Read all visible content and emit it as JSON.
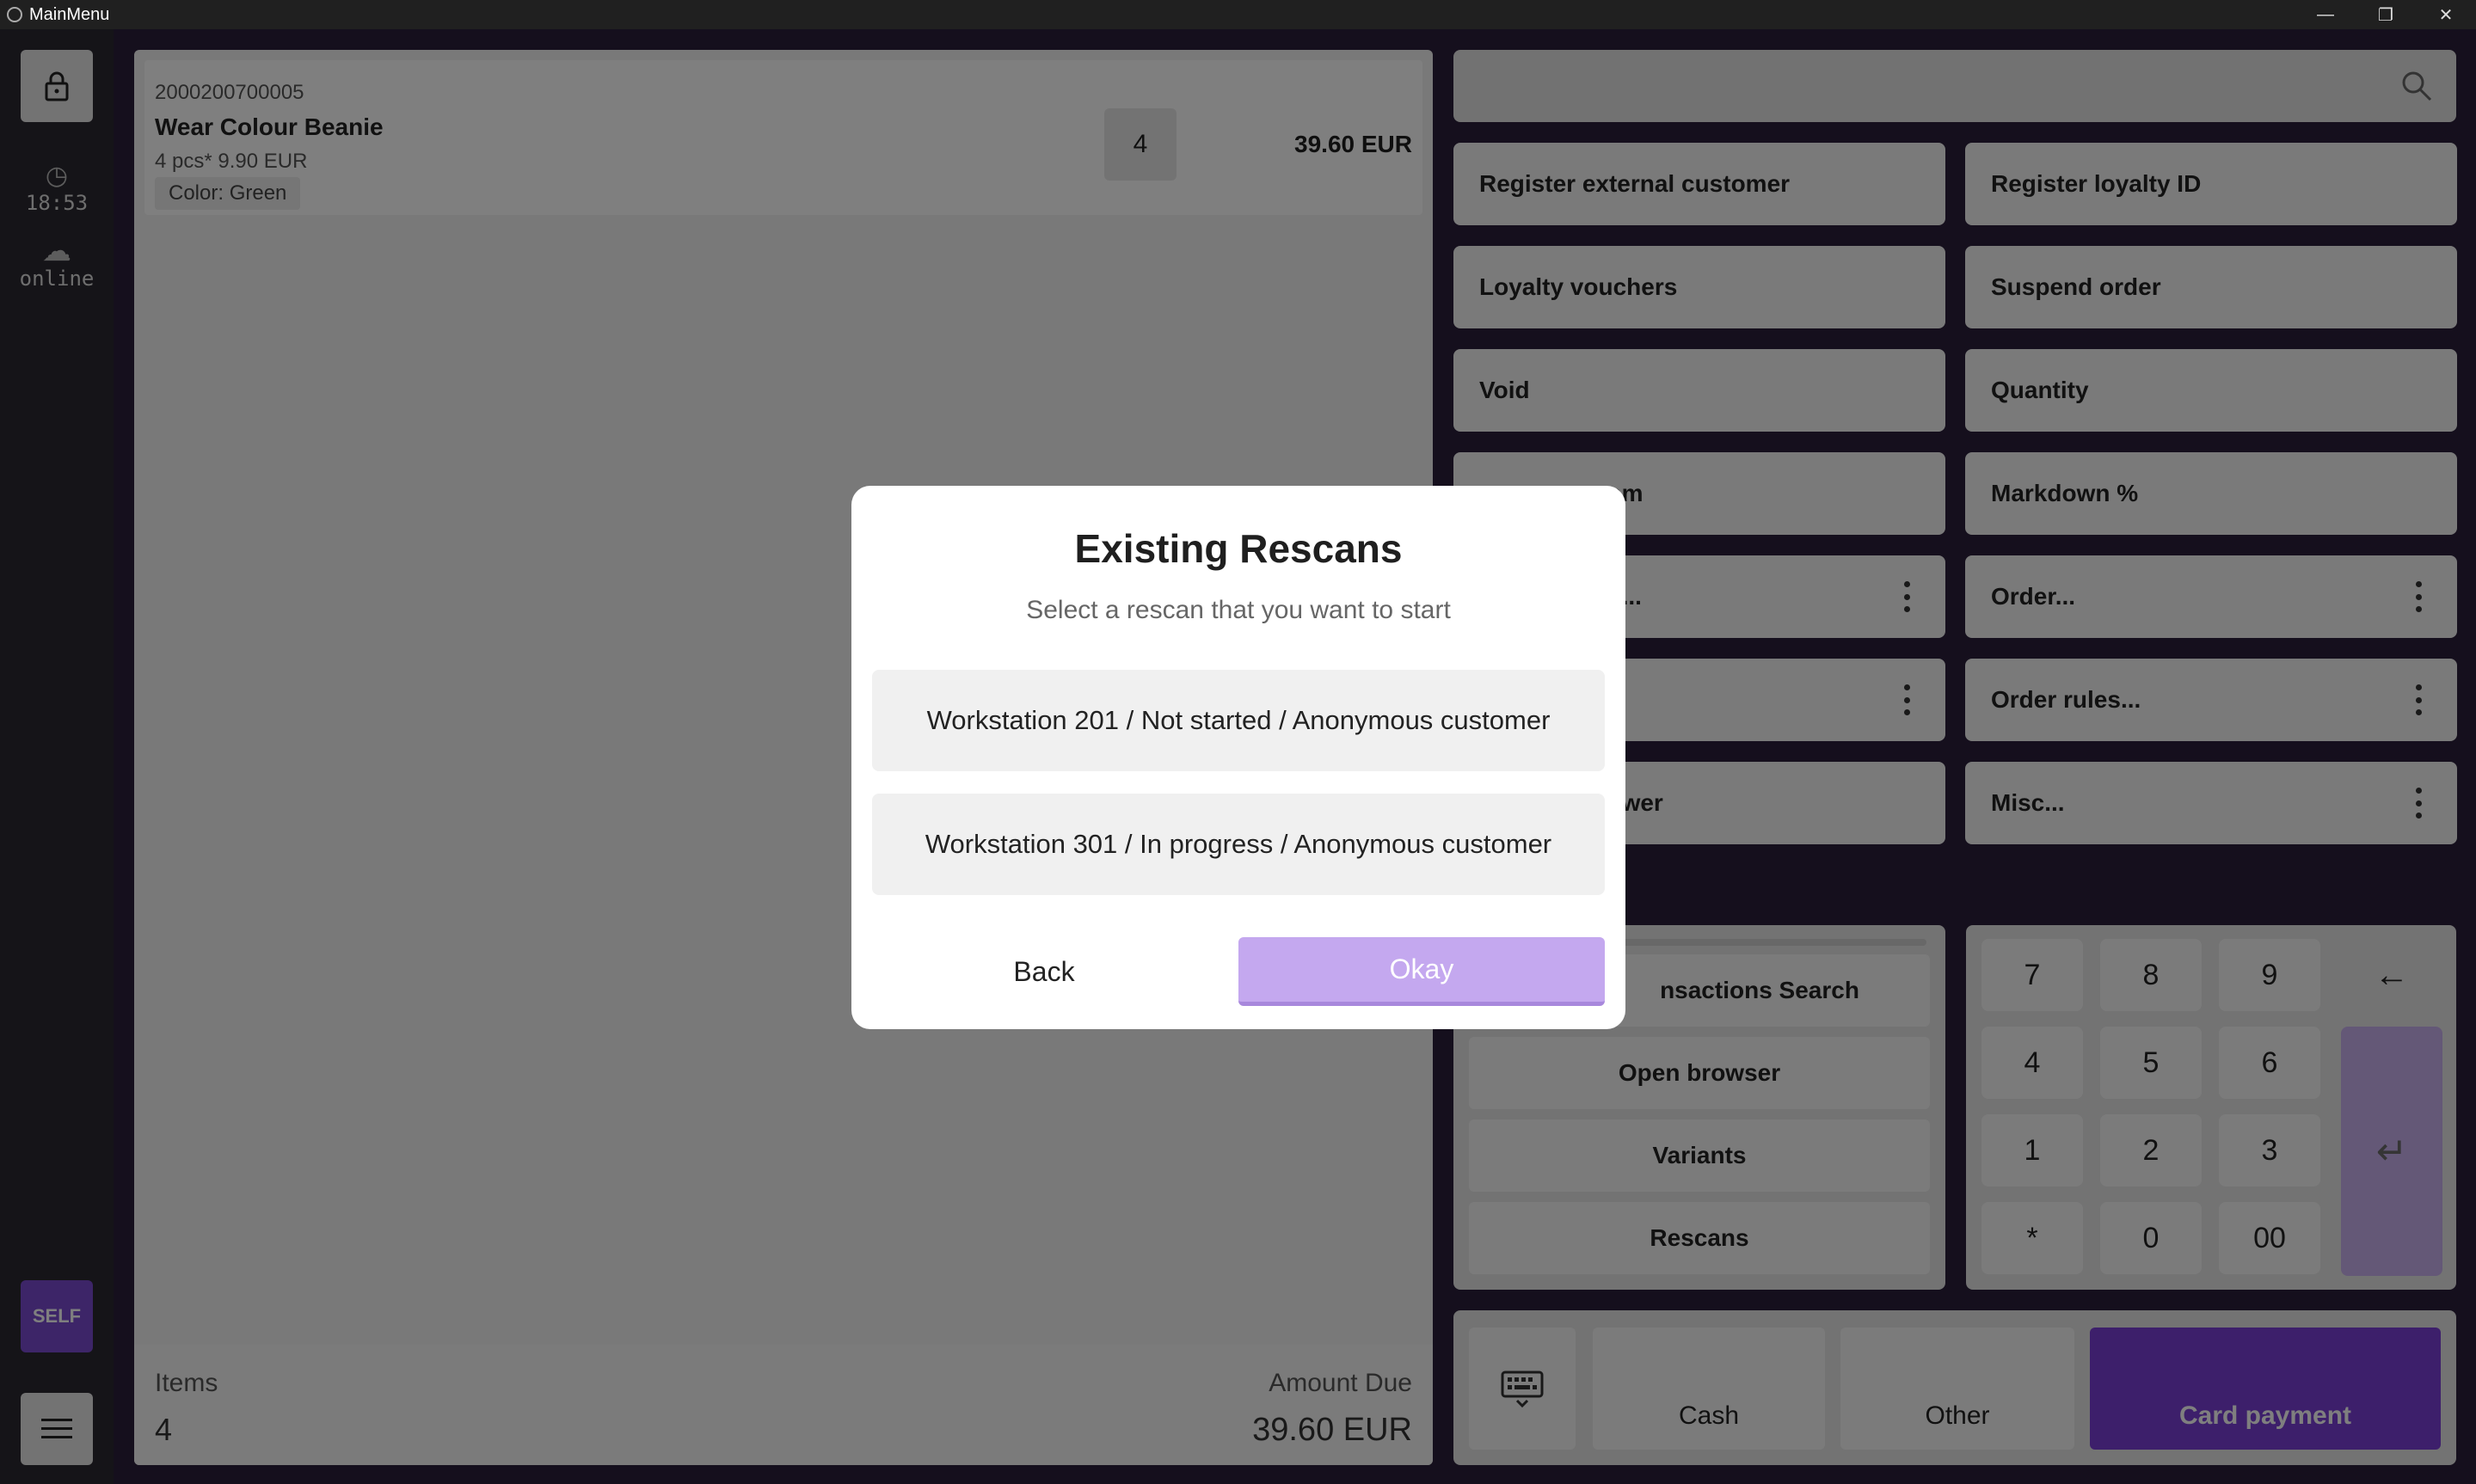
{
  "window": {
    "title": "MainMenu"
  },
  "rail": {
    "time": "18:53",
    "status": "online",
    "self_label": "SELF"
  },
  "cart": {
    "line": {
      "code": "2000200700005",
      "name": "Wear Colour Beanie",
      "qty_price": "4 pcs* 9.90 EUR",
      "variant": "Color: Green",
      "qty": "4",
      "total": "39.60 EUR"
    },
    "footer": {
      "items_label": "Items",
      "items_value": "4",
      "due_label": "Amount Due",
      "due_value": "39.60 EUR"
    }
  },
  "actions": {
    "register_external_customer": "Register external customer",
    "register_loyalty_id": "Register loyalty ID",
    "loyalty_vouchers": "Loyalty vouchers",
    "suspend_order": "Suspend order",
    "void": "Void",
    "quantity": "Quantity",
    "item_partial": "em",
    "markdown": "Markdown %",
    "trans_partial": "s...",
    "order": "Order...",
    "order_rules": "Order rules...",
    "drawer_partial": "awer",
    "misc": "Misc..."
  },
  "quick": {
    "transactions_search": "nsactions Search",
    "open_browser": "Open browser",
    "variants": "Variants",
    "rescans": "Rescans"
  },
  "numpad": {
    "keys": [
      "7",
      "8",
      "9",
      "4",
      "5",
      "6",
      "1",
      "2",
      "3",
      "*",
      "0",
      "00"
    ],
    "back": "←",
    "enter": "↵"
  },
  "payment": {
    "cash": "Cash",
    "other": "Other",
    "card": "Card payment"
  },
  "dialog": {
    "title": "Existing Rescans",
    "subtitle": "Select a rescan that you want to start",
    "options": [
      "Workstation 201 / Not started / Anonymous customer",
      "Workstation 301 / In progress / Anonymous customer"
    ],
    "back": "Back",
    "okay": "Okay"
  },
  "colors": {
    "accent": "#7a3fd6",
    "accent_light": "#c4a8ef",
    "self": "#7a4ad0"
  }
}
